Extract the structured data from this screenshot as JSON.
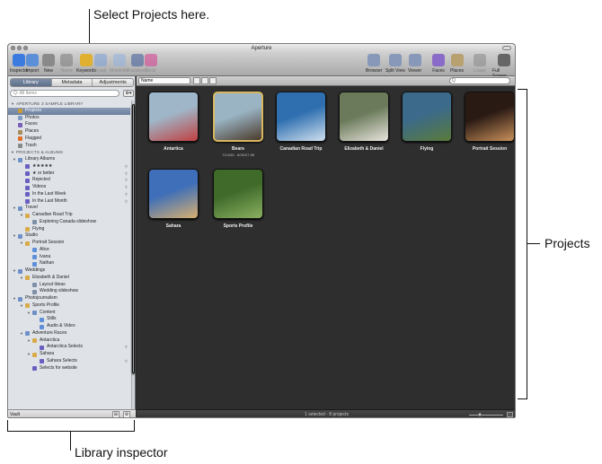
{
  "callouts": {
    "select_projects": "Select Projects here.",
    "projects": "Projects",
    "library_inspector": "Library inspector"
  },
  "window": {
    "title": "Aperture"
  },
  "toolbar": {
    "left": [
      {
        "label": "Inspector",
        "icon": "info-icon",
        "color": "#3b7be0"
      },
      {
        "label": "Import",
        "icon": "import-icon",
        "color": "#5b8fd8"
      },
      {
        "label": "New",
        "icon": "new-icon",
        "color": "#8a8a8a"
      },
      {
        "label": "Name",
        "icon": "person-icon",
        "color": "#7a7a7a"
      },
      {
        "label": "Keywords",
        "icon": "keywords-icon",
        "color": "#e0b030"
      },
      {
        "label": "Email",
        "icon": "email-icon",
        "color": "#7aa0d8"
      },
      {
        "label": "MobileMe",
        "icon": "mobileme-icon",
        "color": "#8fb0e0"
      },
      {
        "label": "Facebook",
        "icon": "facebook-icon",
        "color": "#3b5998"
      },
      {
        "label": "Flickr",
        "icon": "flickr-icon",
        "color": "#d63a8e"
      }
    ],
    "right": [
      {
        "label": "Browser",
        "icon": "browser-icon",
        "color": "#8898b8"
      },
      {
        "label": "Split View",
        "icon": "split-view-icon",
        "color": "#8898b8"
      },
      {
        "label": "Viewer",
        "icon": "viewer-icon",
        "color": "#8898b8"
      },
      {
        "label": "Faces",
        "icon": "faces-icon",
        "color": "#8a6cc8"
      },
      {
        "label": "Places",
        "icon": "places-icon",
        "color": "#b9a070"
      },
      {
        "label": "Loupe",
        "icon": "loupe-icon",
        "color": "#888888"
      },
      {
        "label": "Full Screen",
        "icon": "full-screen-icon",
        "color": "#666666"
      }
    ]
  },
  "sidebar": {
    "tabs": [
      "Library",
      "Metadata",
      "Adjustments"
    ],
    "active_tab": 0,
    "search_placeholder": "Q- All Items",
    "search_action": "⚙▾",
    "rows": [
      {
        "label": "APERTURE 3 SAMPLE LIBRARY",
        "hdr": true,
        "indent": 0,
        "tri": "▼"
      },
      {
        "label": "Projects",
        "indent": 1,
        "icon": "projects-icon",
        "color": "#c79a3c",
        "sel": true
      },
      {
        "label": "Photos",
        "indent": 1,
        "icon": "photos-icon",
        "color": "#7f9ac4"
      },
      {
        "label": "Faces",
        "indent": 1,
        "icon": "faces-icon",
        "color": "#7a5fb8"
      },
      {
        "label": "Places",
        "indent": 1,
        "icon": "places-icon",
        "color": "#a88c5a"
      },
      {
        "label": "Flagged",
        "indent": 1,
        "icon": "flag-icon",
        "color": "#e0702a"
      },
      {
        "label": "Trash",
        "indent": 1,
        "icon": "trash-icon",
        "color": "#8a8a8a"
      },
      {
        "label": "PROJECTS & ALBUMS",
        "hdr": true,
        "indent": 0,
        "tri": "▼"
      },
      {
        "label": "Library Albums",
        "indent": 1,
        "icon": "folder-icon",
        "color": "#6f8fc8",
        "tri": "▼"
      },
      {
        "label": "★★★★★",
        "indent": 2,
        "icon": "smart-album-icon",
        "color": "#6a5fc0",
        "mag": true
      },
      {
        "label": "★ or better",
        "indent": 2,
        "icon": "smart-album-icon",
        "color": "#6a5fc0",
        "mag": true
      },
      {
        "label": "Rejected",
        "indent": 2,
        "icon": "smart-album-icon",
        "color": "#6a5fc0",
        "mag": true
      },
      {
        "label": "Videos",
        "indent": 2,
        "icon": "smart-album-icon",
        "color": "#6a5fc0",
        "mag": true
      },
      {
        "label": "In the Last Week",
        "indent": 2,
        "icon": "smart-album-icon",
        "color": "#6a5fc0",
        "mag": true
      },
      {
        "label": "In the Last Month",
        "indent": 2,
        "icon": "smart-album-icon",
        "color": "#6a5fc0",
        "mag": true
      },
      {
        "label": "Travel",
        "indent": 1,
        "icon": "folder-icon",
        "color": "#6f8fc8",
        "tri": "▼"
      },
      {
        "label": "Canadian Road Trip",
        "indent": 2,
        "icon": "project-icon",
        "color": "#d8aa4a",
        "tri": "▼"
      },
      {
        "label": "Exploring Canada slideshow",
        "indent": 3,
        "icon": "slideshow-icon",
        "color": "#7f8fa8"
      },
      {
        "label": "Flying",
        "indent": 2,
        "icon": "project-icon",
        "color": "#d8aa4a"
      },
      {
        "label": "Studio",
        "indent": 1,
        "icon": "folder-icon",
        "color": "#6f8fc8",
        "tri": "▼"
      },
      {
        "label": "Portrait Session",
        "indent": 2,
        "icon": "project-icon",
        "color": "#d8aa4a",
        "tri": "▼"
      },
      {
        "label": "Alice",
        "indent": 3,
        "icon": "album-icon",
        "color": "#5f8fd8"
      },
      {
        "label": "Ivana",
        "indent": 3,
        "icon": "album-icon",
        "color": "#5f8fd8"
      },
      {
        "label": "Nathan",
        "indent": 3,
        "icon": "album-icon",
        "color": "#5f8fd8"
      },
      {
        "label": "Weddings",
        "indent": 1,
        "icon": "folder-icon",
        "color": "#6f8fc8",
        "tri": "▼"
      },
      {
        "label": "Elizabeth & Daniel",
        "indent": 2,
        "icon": "project-icon",
        "color": "#d8aa4a",
        "tri": "▼"
      },
      {
        "label": "Layout Ideas",
        "indent": 3,
        "icon": "book-icon",
        "color": "#7f8fa8"
      },
      {
        "label": "Wedding slideshow",
        "indent": 3,
        "icon": "slideshow-icon",
        "color": "#7f8fa8"
      },
      {
        "label": "Photojournalism",
        "indent": 1,
        "icon": "folder-icon",
        "color": "#6f8fc8",
        "tri": "▼"
      },
      {
        "label": "Sports Profile",
        "indent": 2,
        "icon": "project-icon",
        "color": "#d8aa4a",
        "tri": "▼"
      },
      {
        "label": "Content",
        "indent": 3,
        "icon": "folder-icon",
        "color": "#6f8fc8",
        "tri": "▼"
      },
      {
        "label": "Stills",
        "indent": 4,
        "icon": "album-icon",
        "color": "#5f8fd8"
      },
      {
        "label": "Audio & Video",
        "indent": 4,
        "icon": "album-icon",
        "color": "#5f8fd8"
      },
      {
        "label": "Adventure Races",
        "indent": 2,
        "icon": "folder-icon",
        "color": "#6f8fc8",
        "tri": "▼"
      },
      {
        "label": "Antarctica",
        "indent": 3,
        "icon": "project-icon",
        "color": "#d8aa4a",
        "tri": "▼"
      },
      {
        "label": "Antarctica Selects",
        "indent": 4,
        "icon": "smart-album-icon",
        "color": "#6a5fc0",
        "mag": true
      },
      {
        "label": "Sahara",
        "indent": 3,
        "icon": "project-icon",
        "color": "#d8aa4a",
        "tri": "▼"
      },
      {
        "label": "Sahara Selects",
        "indent": 4,
        "icon": "smart-album-icon",
        "color": "#6a5fc0",
        "mag": true
      },
      {
        "label": "Selects for website",
        "indent": 3,
        "icon": "smart-album-icon",
        "color": "#6a5fc0"
      }
    ],
    "footer": {
      "label": "Vault",
      "btn1": "⊞",
      "btn2": "⚙"
    }
  },
  "browser": {
    "sort": "Name",
    "search": "Q",
    "projects": [
      {
        "name": "Antartica",
        "c1": "#9fb6c8",
        "c2": "#c04040"
      },
      {
        "name": "Bears",
        "sub": "7/14/05 - 8/26/07   88",
        "c1": "#9ab4c4",
        "c2": "#4a3a2a",
        "sel": true
      },
      {
        "name": "Canadian Road Trip",
        "c1": "#2f6fb0",
        "c2": "#cfe0ee"
      },
      {
        "name": "Elizabeth & Daniel",
        "c1": "#6a7a5a",
        "c2": "#e8e4dc"
      },
      {
        "name": "Flying",
        "c1": "#3b6a8a",
        "c2": "#5a7a3a"
      },
      {
        "name": "Portrait Session",
        "c1": "#2a1a14",
        "c2": "#c8905a"
      },
      {
        "name": "Sahara",
        "c1": "#3f6fb8",
        "c2": "#d8b070"
      },
      {
        "name": "Sports Profile",
        "c1": "#3f6a2a",
        "c2": "#8ab060"
      }
    ],
    "status": "1 selected - 8 projects"
  }
}
